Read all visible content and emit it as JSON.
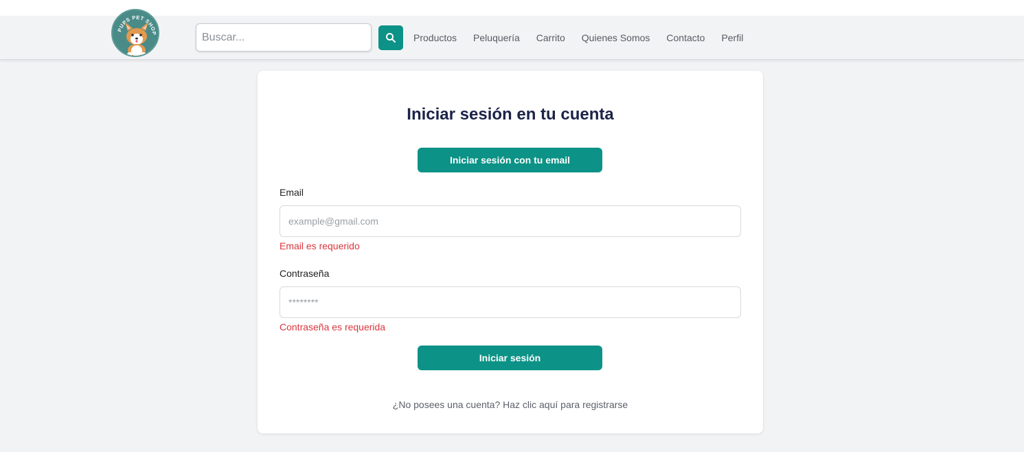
{
  "header": {
    "logo_text": "PUPS PET SHOP",
    "search_placeholder": "Buscar...",
    "nav": [
      "Productos",
      "Peluquería",
      "Carrito",
      "Quienes Somos",
      "Contacto",
      "Perfil"
    ]
  },
  "login": {
    "title": "Iniciar sesión en tu cuenta",
    "email_login_button": "Iniciar sesión con tu email",
    "email_label": "Email",
    "email_placeholder": "example@gmail.com",
    "email_error": "Email es requerido",
    "password_label": "Contraseña",
    "password_placeholder": "********",
    "password_error": "Contraseña es requerida",
    "submit_button": "Iniciar sesión",
    "register_text": "¿No posees una cuenta? Haz clic aquí para registrarse"
  },
  "colors": {
    "accent": "#0c9286",
    "error": "#d9363e",
    "title": "#1b2347",
    "background": "#f2f3f5"
  },
  "icons": {
    "search": "search-icon",
    "logo": "corgi-logo"
  }
}
